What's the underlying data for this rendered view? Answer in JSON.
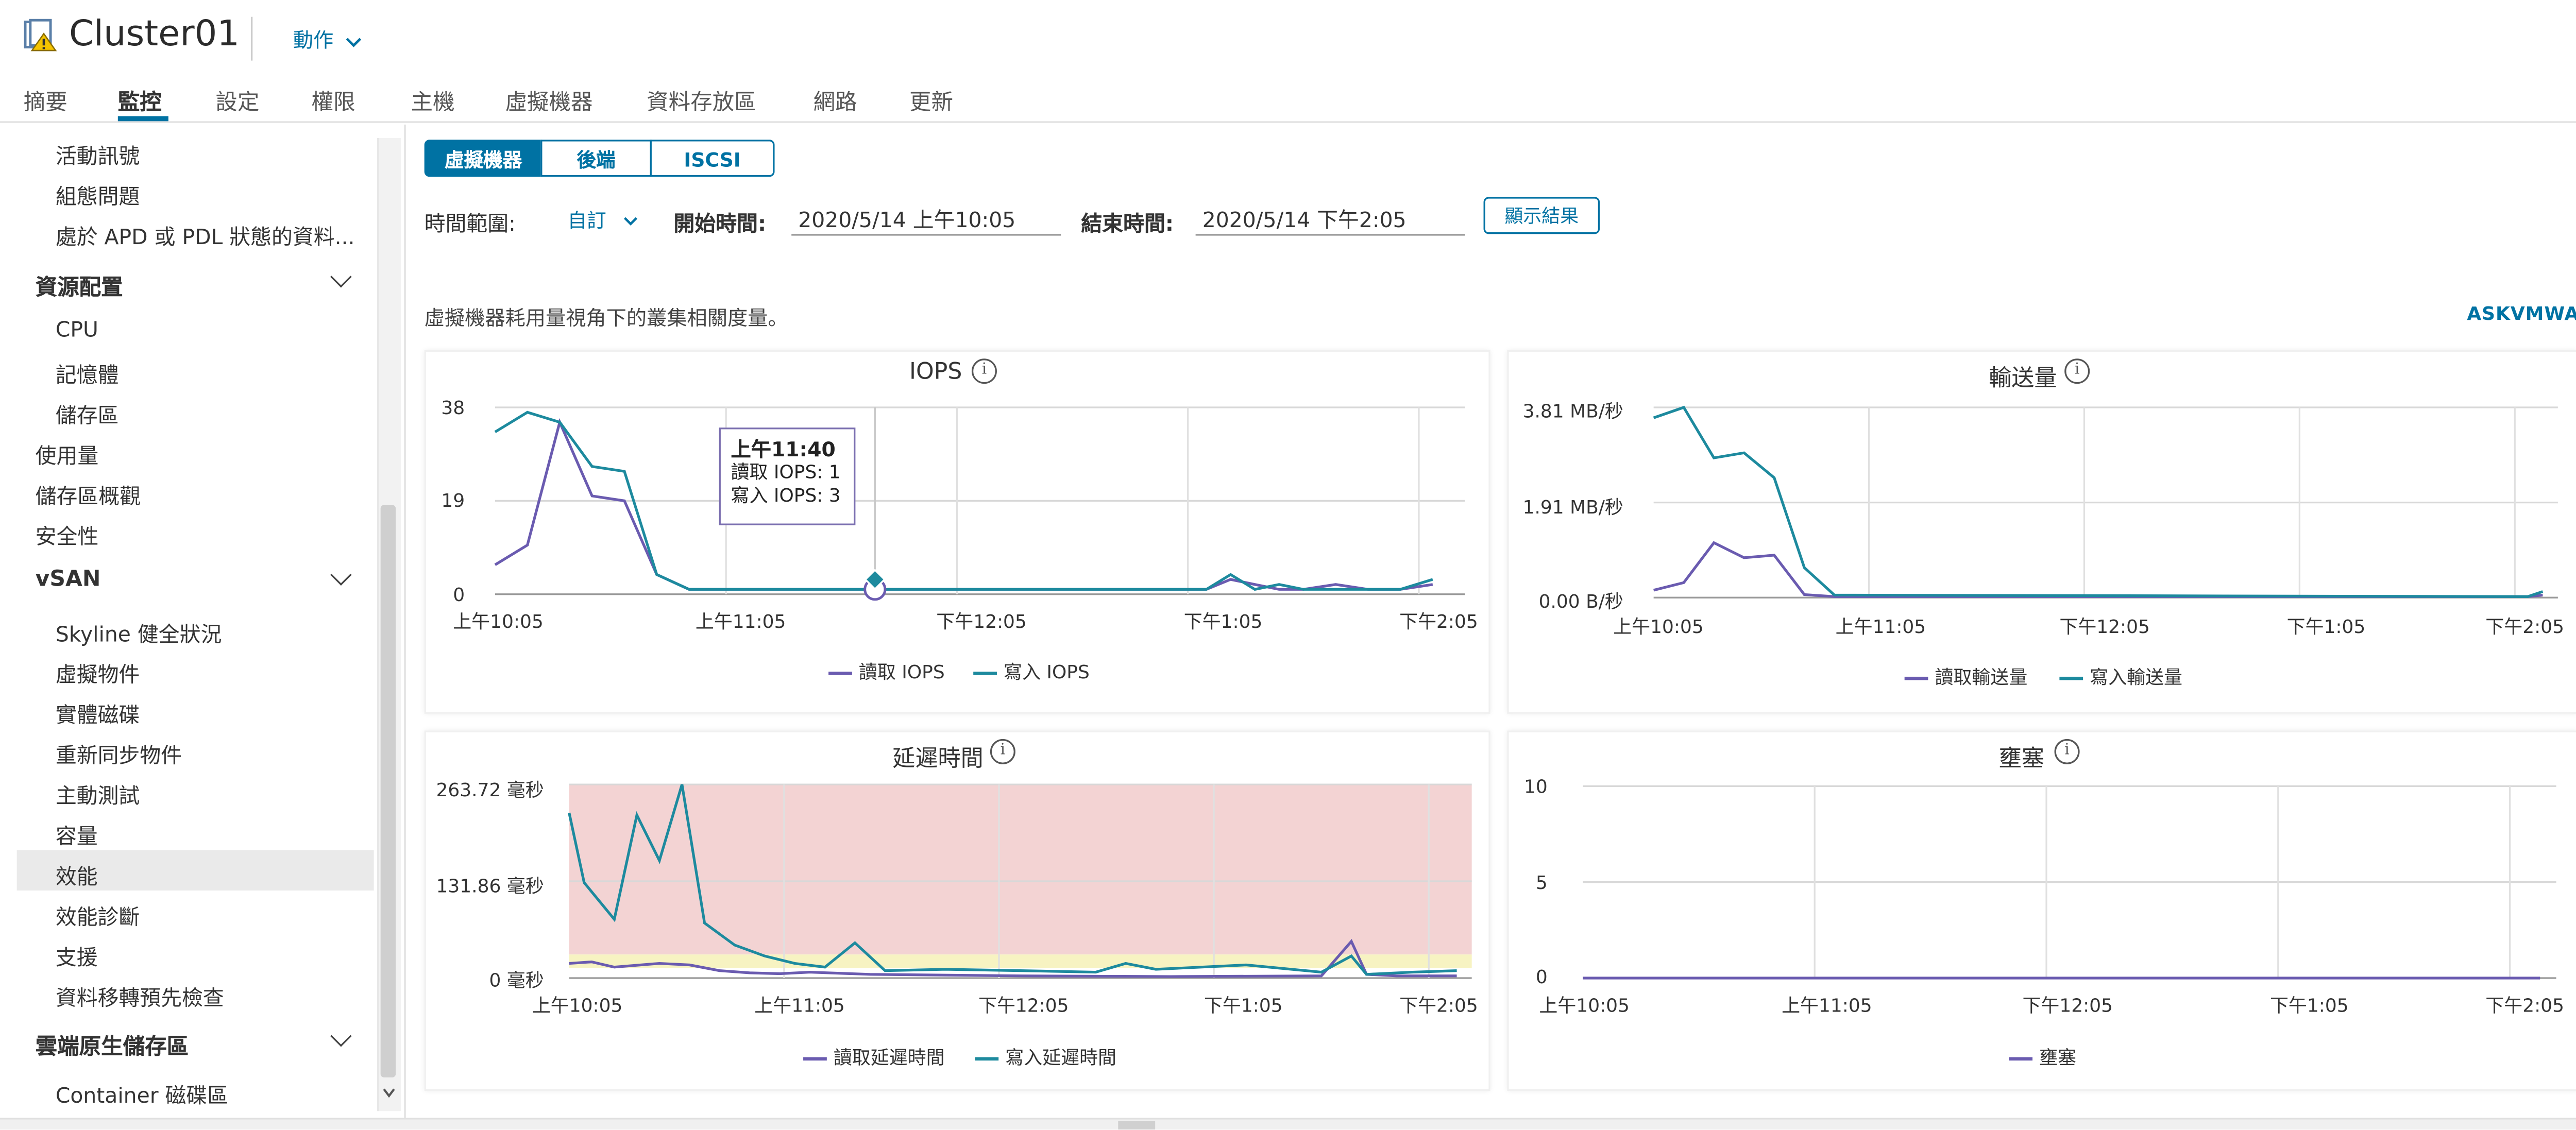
{
  "header": {
    "title": "Cluster01",
    "actions_label": "動作"
  },
  "tabs": [
    "摘要",
    "監控",
    "設定",
    "權限",
    "主機",
    "虛擬機器",
    "資料存放區",
    "網路",
    "更新"
  ],
  "nav": {
    "items": [
      {
        "label": "活動訊號",
        "type": "sub"
      },
      {
        "label": "組態問題",
        "type": "sub"
      },
      {
        "label": "處於 APD 或 PDL 狀態的資料...",
        "type": "sub"
      },
      {
        "label": "資源配置",
        "type": "group"
      },
      {
        "label": "CPU",
        "type": "sub"
      },
      {
        "label": "記憶體",
        "type": "sub"
      },
      {
        "label": "儲存區",
        "type": "sub"
      },
      {
        "label": "使用量",
        "type": "top"
      },
      {
        "label": "儲存區概觀",
        "type": "top"
      },
      {
        "label": "安全性",
        "type": "top"
      },
      {
        "label": "vSAN",
        "type": "group"
      },
      {
        "label": "Skyline 健全狀況",
        "type": "sub"
      },
      {
        "label": "虛擬物件",
        "type": "sub"
      },
      {
        "label": "實體磁碟",
        "type": "sub"
      },
      {
        "label": "重新同步物件",
        "type": "sub"
      },
      {
        "label": "主動測試",
        "type": "sub"
      },
      {
        "label": "容量",
        "type": "sub"
      },
      {
        "label": "效能",
        "type": "sub",
        "selected": true
      },
      {
        "label": "效能診斷",
        "type": "sub"
      },
      {
        "label": "支援",
        "type": "sub"
      },
      {
        "label": "資料移轉預先檢查",
        "type": "sub"
      },
      {
        "label": "雲端原生儲存區",
        "type": "group"
      },
      {
        "label": "Container 磁碟區",
        "type": "sub"
      }
    ]
  },
  "segments": [
    "虛擬機器",
    "後端",
    "ISCSI"
  ],
  "filters": {
    "range_label": "時間範圍:",
    "range_value": "自訂",
    "start_label": "開始時間:",
    "start_value": "2020/5/14 上午10:05",
    "end_label": "結束時間:",
    "end_value": "2020/5/14 下午2:05",
    "show_button": "顯示結果"
  },
  "description": "虛擬機器耗用量視角下的叢集相關度量。",
  "askvmware": "ASKVMWARE",
  "colors": {
    "accent": "#0072a3",
    "read": "#6a5bb0",
    "write": "#1d8a9e",
    "latency_bg": "#f3d3d3",
    "latency_warn": "#f7f3c2"
  },
  "tooltip": {
    "time": "上午11:40",
    "read": "讀取 IOPS: 1",
    "write": "寫入 IOPS: 3"
  },
  "chart_data": [
    {
      "type": "line",
      "title": "IOPS",
      "x": [
        "上午10:05",
        "上午11:05",
        "下午12:05",
        "下午1:05",
        "下午2:05"
      ],
      "yticks": [
        "38",
        "19",
        "0"
      ],
      "ylim": [
        0,
        38
      ],
      "series": [
        {
          "name": "讀取 IOPS",
          "color": "#6a5bb0",
          "points": [
            [
              0,
              6
            ],
            [
              4,
              10
            ],
            [
              8,
              35
            ],
            [
              12,
              20
            ],
            [
              16,
              19
            ],
            [
              20,
              4
            ],
            [
              24,
              1
            ],
            [
              70,
              1
            ],
            [
              88,
              1
            ],
            [
              91,
              3
            ],
            [
              94,
              2
            ],
            [
              97,
              1
            ],
            [
              100,
              1
            ],
            [
              104,
              2
            ],
            [
              108,
              1
            ],
            [
              112,
              1
            ],
            [
              116,
              2
            ]
          ]
        },
        {
          "name": "寫入 IOPS",
          "color": "#1d8a9e",
          "points": [
            [
              0,
              33
            ],
            [
              4,
              37
            ],
            [
              8,
              35
            ],
            [
              12,
              26
            ],
            [
              16,
              25
            ],
            [
              20,
              4
            ],
            [
              24,
              1
            ],
            [
              70,
              1
            ],
            [
              88,
              1
            ],
            [
              91,
              4
            ],
            [
              94,
              1
            ],
            [
              97,
              2
            ],
            [
              100,
              1
            ],
            [
              104,
              1
            ],
            [
              108,
              1
            ],
            [
              112,
              1
            ],
            [
              116,
              3
            ]
          ]
        }
      ]
    },
    {
      "type": "line",
      "title": "輸送量",
      "x": [
        "上午10:05",
        "上午11:05",
        "下午12:05",
        "下午1:05",
        "下午2:05"
      ],
      "yticks": [
        "3.81 MB/秒",
        "1.91 MB/秒",
        "0.00 B/秒"
      ],
      "ylim": [
        0,
        3.81
      ],
      "series": [
        {
          "name": "讀取輸送量",
          "color": "#6a5bb0",
          "points": [
            [
              0,
              0.15
            ],
            [
              4,
              0.3
            ],
            [
              8,
              1.1
            ],
            [
              12,
              0.8
            ],
            [
              16,
              0.85
            ],
            [
              20,
              0.06
            ],
            [
              24,
              0.02
            ],
            [
              116,
              0.02
            ],
            [
              118,
              0.05
            ]
          ]
        },
        {
          "name": "寫入輸送量",
          "color": "#1d8a9e",
          "points": [
            [
              0,
              3.6
            ],
            [
              4,
              3.81
            ],
            [
              8,
              2.8
            ],
            [
              12,
              2.9
            ],
            [
              16,
              2.4
            ],
            [
              20,
              0.6
            ],
            [
              24,
              0.05
            ],
            [
              116,
              0.02
            ],
            [
              118,
              0.12
            ]
          ]
        }
      ]
    },
    {
      "type": "line",
      "title": "延遲時間",
      "x": [
        "上午10:05",
        "上午11:05",
        "下午12:05",
        "下午1:05",
        "下午2:05"
      ],
      "yticks": [
        "263.72 毫秒",
        "131.86 毫秒",
        "0 毫秒"
      ],
      "ylim": [
        0,
        263.72
      ],
      "series": [
        {
          "name": "讀取延遲時間",
          "color": "#6a5bb0",
          "points": [
            [
              0,
              20
            ],
            [
              3,
              22
            ],
            [
              6,
              15
            ],
            [
              12,
              20
            ],
            [
              16,
              18
            ],
            [
              20,
              10
            ],
            [
              24,
              7
            ],
            [
              28,
              6
            ],
            [
              32,
              8
            ],
            [
              40,
              5
            ],
            [
              60,
              3
            ],
            [
              80,
              2
            ],
            [
              100,
              3
            ],
            [
              104,
              50
            ],
            [
              106,
              5
            ],
            [
              110,
              3
            ],
            [
              118,
              3
            ]
          ]
        },
        {
          "name": "寫入延遲時間",
          "color": "#1d8a9e",
          "points": [
            [
              0,
              225
            ],
            [
              2,
              130
            ],
            [
              6,
              80
            ],
            [
              9,
              222
            ],
            [
              12,
              160
            ],
            [
              15,
              265
            ],
            [
              18,
              75
            ],
            [
              22,
              45
            ],
            [
              26,
              30
            ],
            [
              30,
              20
            ],
            [
              34,
              15
            ],
            [
              38,
              48
            ],
            [
              42,
              10
            ],
            [
              50,
              12
            ],
            [
              60,
              10
            ],
            [
              70,
              8
            ],
            [
              74,
              20
            ],
            [
              78,
              12
            ],
            [
              90,
              18
            ],
            [
              100,
              8
            ],
            [
              104,
              30
            ],
            [
              106,
              5
            ],
            [
              112,
              8
            ],
            [
              118,
              10
            ]
          ]
        }
      ]
    },
    {
      "type": "line",
      "title": "壅塞",
      "x": [
        "上午10:05",
        "上午11:05",
        "下午12:05",
        "下午1:05",
        "下午2:05"
      ],
      "yticks": [
        "10",
        "5",
        "0"
      ],
      "ylim": [
        0,
        10
      ],
      "series": [
        {
          "name": "壅塞",
          "color": "#6a5bb0",
          "points": [
            [
              0,
              0
            ],
            [
              118,
              0
            ]
          ]
        }
      ]
    }
  ]
}
